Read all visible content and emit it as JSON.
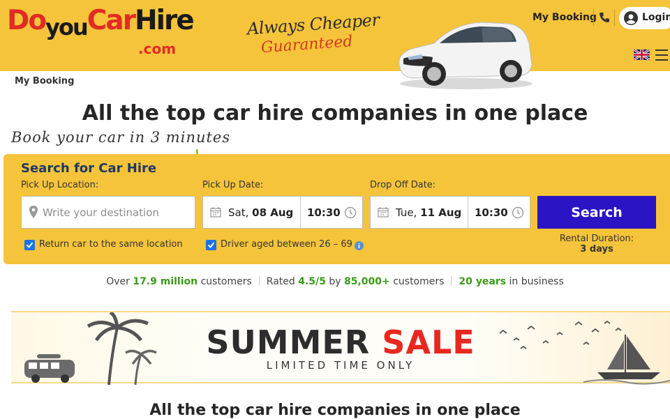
{
  "header": {
    "logo": {
      "do": "Do",
      "you": "you",
      "car": "Car",
      "hire": "Hire",
      "com": ".com"
    },
    "slogan_line1": "Always Cheaper",
    "slogan_line2": "Guaranteed",
    "my_booking": "My Booking",
    "login": "Login",
    "language": "English (UK)"
  },
  "breadcrumb": "My Booking",
  "headline": "All the top car hire companies in one place",
  "tagline": "Book your car in 3 minutes",
  "search": {
    "title": "Search for Car Hire",
    "pickup_location_label": "Pick Up Location:",
    "pickup_location_placeholder": "Write your destination",
    "pickup_date_label": "Pick Up Date:",
    "pickup_day": "Sat,",
    "pickup_date": "08 Aug",
    "pickup_time": "10:30",
    "dropoff_date_label": "Drop Off Date:",
    "dropoff_day": "Tue,",
    "dropoff_date": "11 Aug",
    "dropoff_time": "10:30",
    "search_button": "Search",
    "same_location_label": "Return car to the same location",
    "same_location_checked": true,
    "driver_age_label": "Driver aged between 26 – 69",
    "driver_age_checked": true,
    "rental_duration_label": "Rental Duration:",
    "rental_duration_value": "3 days"
  },
  "stats": {
    "s1_pre": "Over ",
    "s1_value": "17.9 million",
    "s1_post": " customers",
    "s2_pre": "Rated ",
    "s2_rating": "4.5/5",
    "s2_mid": " by ",
    "s2_count": "85,000+",
    "s2_post": " customers",
    "s3_value": "20 years",
    "s3_post": " in business"
  },
  "banner": {
    "word1": "SUMMER ",
    "word2": "SALE",
    "subtitle": "LIMITED TIME ONLY"
  },
  "section_heading": "All the top car hire companies in one place",
  "colors": {
    "header_bg": "#f5c43a",
    "search_button": "#2a14c4",
    "accent_green": "#3a9a1a",
    "sale_red": "#e8271f"
  }
}
